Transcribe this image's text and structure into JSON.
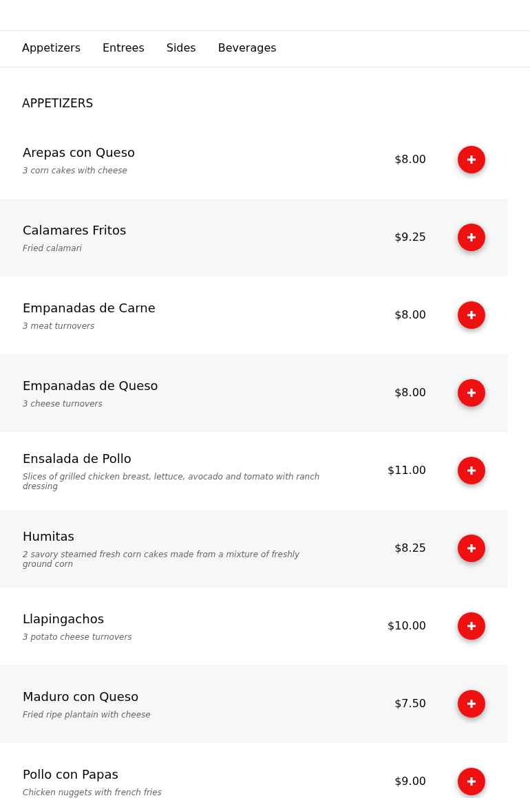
{
  "tabs": [
    {
      "label": "Appetizers",
      "selected": false
    },
    {
      "label": "Entrees",
      "selected": false
    },
    {
      "label": "Sides",
      "selected": false
    },
    {
      "label": "Beverages",
      "selected": false
    }
  ],
  "section": {
    "title": "APPETIZERS"
  },
  "items": [
    {
      "name": "Arepas con Queso",
      "description": "3 corn cakes with cheese",
      "price": "$8.00"
    },
    {
      "name": "Calamares Fritos",
      "description": "Fried calamari",
      "price": "$9.25"
    },
    {
      "name": "Empanadas de Carne",
      "description": "3 meat turnovers",
      "price": "$8.00"
    },
    {
      "name": "Empanadas de Queso",
      "description": "3 cheese turnovers",
      "price": "$8.00"
    },
    {
      "name": "Ensalada de Pollo",
      "description": "Slices of grilled chicken breast, lettuce, avocado and tomato with ranch dressing",
      "price": "$11.00"
    },
    {
      "name": "Humitas",
      "description": "2 savory steamed fresh corn cakes made from a mixture of freshly ground corn",
      "price": "$8.25"
    },
    {
      "name": "Llapingachos",
      "description": "3 potato cheese turnovers",
      "price": "$10.00"
    },
    {
      "name": "Maduro con Queso",
      "description": "Fried ripe plantain with cheese",
      "price": "$7.50"
    },
    {
      "name": "Pollo con Papas",
      "description": "Chicken nuggets with french fries",
      "price": "$9.00"
    }
  ]
}
